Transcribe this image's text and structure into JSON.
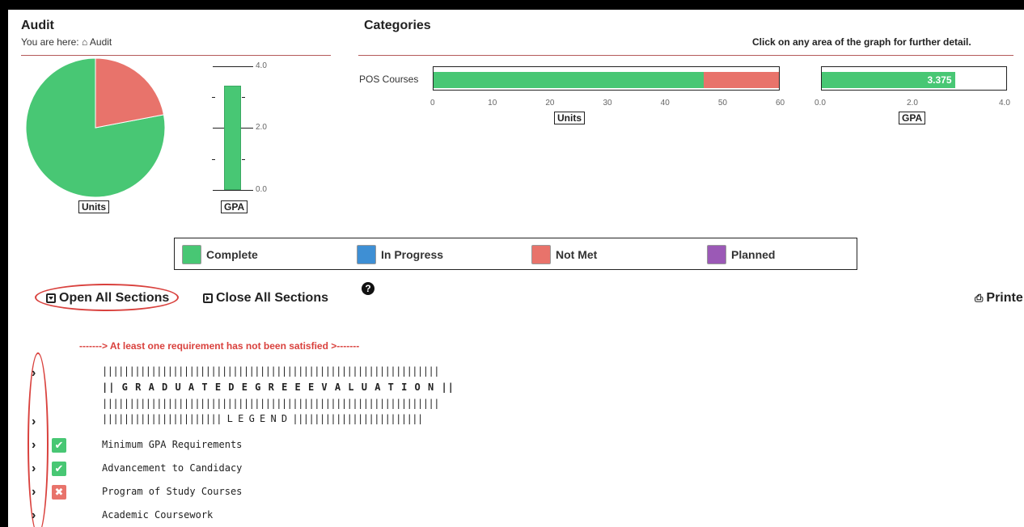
{
  "audit": {
    "title": "Audit",
    "breadcrumb_prefix": "You are here:",
    "breadcrumb_item": "Audit"
  },
  "categories": {
    "title": "Categories",
    "hint": "Click on any area of the graph for further detail."
  },
  "overall_units": {
    "label": "Units",
    "complete_pct": 0.78,
    "not_met_pct": 0.22
  },
  "overall_gpa": {
    "label": "GPA",
    "ticks": [
      "4.0",
      "2.0",
      "0.0"
    ],
    "value": 3.375,
    "max": 4.0
  },
  "pos_chart": {
    "category": "POS Courses",
    "units_label": "Units",
    "units_ticks": [
      "0",
      "10",
      "20",
      "30",
      "40",
      "50",
      "60"
    ],
    "units_complete": 47,
    "units_not_met": 13,
    "units_max": 60,
    "gpa_label": "GPA",
    "gpa_ticks": [
      "0.0",
      "2.0",
      "4.0"
    ],
    "gpa_value": 3.375,
    "gpa_value_text": "3.375",
    "gpa_max": 4.0
  },
  "legend": [
    {
      "label": "Complete",
      "color": "#48c774"
    },
    {
      "label": "In Progress",
      "color": "#3e8fd4"
    },
    {
      "label": "Not Met",
      "color": "#e8736b"
    },
    {
      "label": "Planned",
      "color": "#9b59b6"
    }
  ],
  "controls": {
    "open_all": "Open All Sections",
    "close_all": "Close All Sections",
    "print": "Printe"
  },
  "warning": "-------> At least one requirement has not been satisfied >-------",
  "banner": [
    "||||||||||||||||||||||||||||||||||||||||||||||||||||||||||||||",
    "|| G R A D U A T E D E G R E E E V A L U A T I O N ||",
    "||||||||||||||||||||||||||||||||||||||||||||||||||||||||||||||",
    "|||||||||||||||||||||| L E G E N D ||||||||||||||||||||||||"
  ],
  "requirements": [
    {
      "label": "Minimum GPA Requirements",
      "status": "ok"
    },
    {
      "label": "Advancement to Candidacy",
      "status": "ok"
    },
    {
      "label": "Program of Study Courses",
      "status": "fail"
    },
    {
      "label": "Academic Coursework",
      "status": "none"
    }
  ],
  "colors": {
    "complete": "#48c774",
    "not_met": "#e8736b",
    "annotation": "#d9413d",
    "rule": "#b55a5a"
  }
}
